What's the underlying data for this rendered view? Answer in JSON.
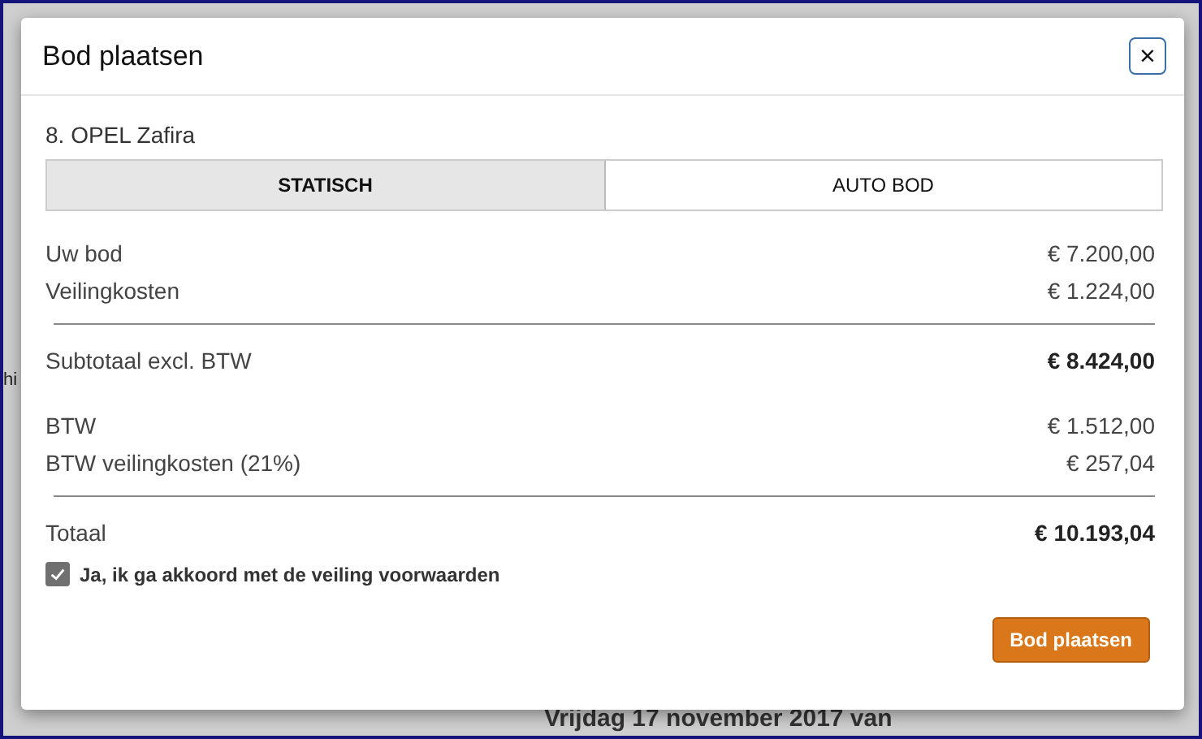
{
  "background": {
    "side_text": "hi",
    "date_text": "Vrijdag 17 november 2017 van"
  },
  "dialog": {
    "title": "Bod plaatsen",
    "close": "×",
    "subtitle": "8. OPEL Zafira",
    "tabs": [
      {
        "label": "STATISCH",
        "selected": true
      },
      {
        "label": "AUTO BOD",
        "selected": false
      }
    ],
    "groups": [
      {
        "rows": [
          {
            "label": "Uw bod",
            "value": "€ 7.200,00",
            "bold": false
          },
          {
            "label": "Veilingkosten",
            "value": "€ 1.224,00",
            "bold": false
          }
        ]
      },
      {
        "rows": [
          {
            "label": "Subtotaal excl. BTW",
            "value": "€ 8.424,00",
            "bold": true
          }
        ]
      },
      {
        "rows": [
          {
            "label": "BTW",
            "value": "€ 1.512,00",
            "bold": false
          },
          {
            "label": "BTW veilingkosten (21%)",
            "value": "€ 257,04",
            "bold": false
          }
        ]
      },
      {
        "rows": [
          {
            "label": "Totaal",
            "value": "€ 10.193,04",
            "bold": true
          }
        ]
      }
    ],
    "agree": {
      "label": "Ja, ik ga akkoord met de veiling voorwaarden",
      "checked": true
    },
    "submit": "Bod plaatsen"
  }
}
